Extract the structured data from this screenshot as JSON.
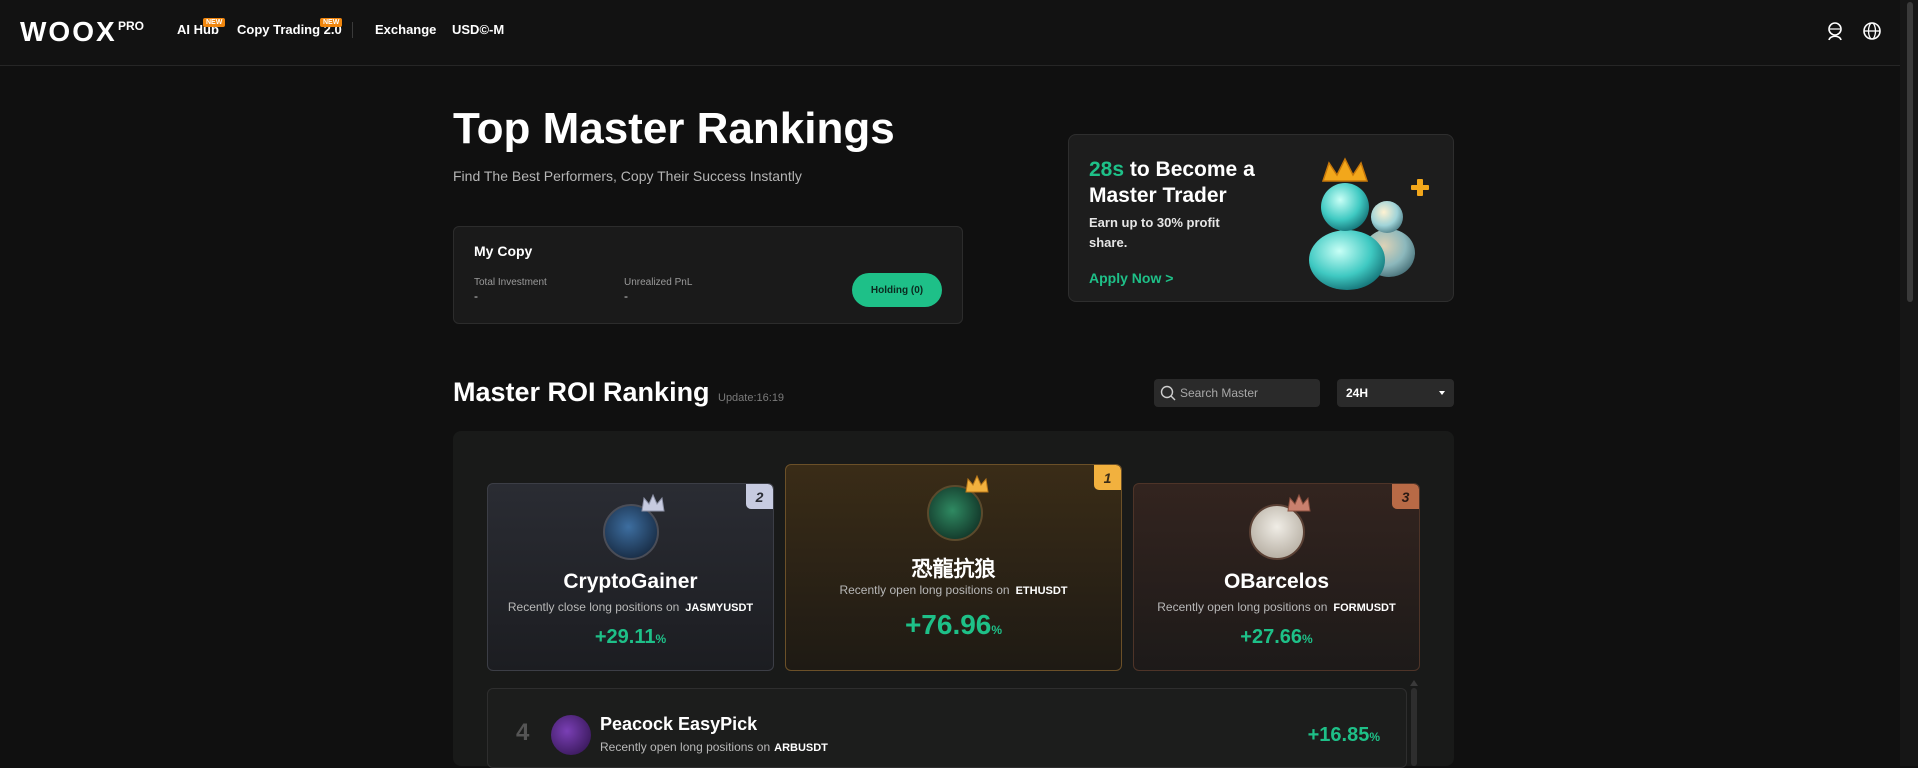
{
  "header": {
    "logo": "WOOX",
    "logo_suffix": "PRO",
    "nav": [
      {
        "label": "AI Hub",
        "badge": "NEW"
      },
      {
        "label": "Copy Trading 2.0",
        "badge": "NEW"
      },
      {
        "label": "Exchange"
      },
      {
        "label": "USD©-M"
      }
    ],
    "icons": [
      "user-icon",
      "globe-icon"
    ]
  },
  "hero": {
    "title": "Top Master Rankings",
    "subtitle": "Find The Best Performers, Copy Their Success Instantly"
  },
  "my_copy": {
    "title": "My Copy",
    "total_investment_label": "Total Investment",
    "total_investment_value": "-",
    "unrealized_pnl_label": "Unrealized PnL",
    "unrealized_pnl_value": "-",
    "holding_button": "Holding (0)"
  },
  "promo": {
    "highlight": "28s",
    "title_rest": " to Become a Master Trader",
    "text": "Earn up to 30% profit share.",
    "link": "Apply Now >"
  },
  "ranking": {
    "title": "Master ROI Ranking",
    "update": "Update:16:19",
    "search_placeholder": "Search Master",
    "period": "24H",
    "top3": [
      {
        "rank": "2",
        "name": "CryptoGainer",
        "desc": "Recently close long positions on",
        "symbol": "JASMYUSDT",
        "roi": "+29.11",
        "unit": "%"
      },
      {
        "rank": "1",
        "name": "恐龍抗狼",
        "desc": "Recently open long positions on",
        "symbol": "ETHUSDT",
        "roi": "+76.96",
        "unit": "%"
      },
      {
        "rank": "3",
        "name": "OBarcelos",
        "desc": "Recently open long positions on",
        "symbol": "FORMUSDT",
        "roi": "+27.66",
        "unit": "%"
      }
    ],
    "list": [
      {
        "rank": "4",
        "name": "Peacock EasyPick",
        "desc": "Recently open long positions on",
        "symbol": "ARBUSDT",
        "roi": "+16.85",
        "unit": "%"
      }
    ]
  },
  "colors": {
    "accent": "#1ec088",
    "gold": "#f2b13e",
    "silver": "#c7cbe0",
    "bronze": "#b86a46",
    "badge": "#f0860e"
  }
}
